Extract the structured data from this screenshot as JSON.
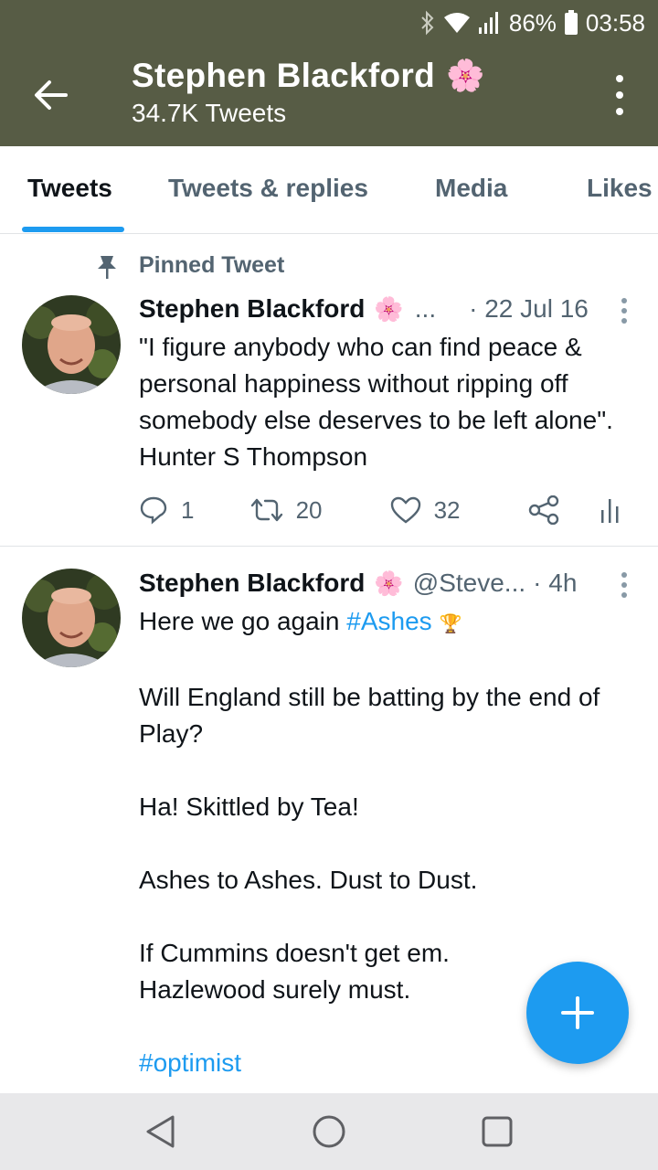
{
  "status_bar": {
    "battery": "86%",
    "time": "03:58",
    "icons": [
      "bluetooth-icon",
      "wifi-icon",
      "signal-icon",
      "battery-icon"
    ]
  },
  "header": {
    "name": "Stephen Blackford",
    "emoji": "🌸",
    "tweet_count": "34.7K Tweets",
    "background": "#575c45"
  },
  "tabs": [
    {
      "label": "Tweets",
      "active": true
    },
    {
      "label": "Tweets & replies",
      "active": false
    },
    {
      "label": "Media",
      "active": false
    },
    {
      "label": "Likes",
      "active": false
    }
  ],
  "pinned_tweet": {
    "pinned_label": "Pinned Tweet",
    "name": "Stephen Blackford",
    "emoji": "🌸",
    "handle": "...",
    "date": "· 22 Jul 16",
    "text": "\"I figure anybody who can find peace & personal happiness without ripping off somebody else deserves to be left alone\". Hunter S Thompson",
    "replies": "1",
    "retweets": "20",
    "likes": "32"
  },
  "tweet2": {
    "name": "Stephen Blackford",
    "emoji": "🌸",
    "handle": "@Steve...",
    "time": "· 4h",
    "line1_prefix": "Here we go again ",
    "line1_hashtag": "#Ashes",
    "line1_emoji": "🏆",
    "para2": "Will England still be batting by the end of Play?",
    "para3": "Ha! Skittled by Tea!",
    "para4": "Ashes to Ashes. Dust to Dust.",
    "para5": "If Cummins doesn't get em.\nHazlewood surely must.",
    "hashtag_end": "#optimist"
  },
  "colors": {
    "accent": "#1d9bf0",
    "muted": "#536471"
  }
}
